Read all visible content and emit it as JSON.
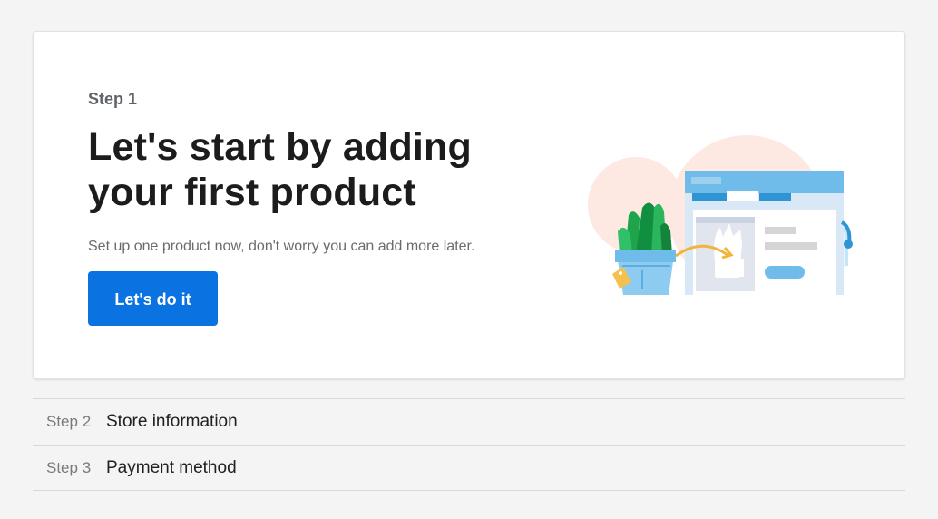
{
  "hero": {
    "step_label": "Step 1",
    "headline": "Let's start by adding your first product",
    "subtext": "Set up one product now, don't worry you can add more later.",
    "cta_label": "Let's do it"
  },
  "steps": [
    {
      "number": "Step 2",
      "title": "Store information"
    },
    {
      "number": "Step 3",
      "title": "Payment method"
    }
  ],
  "colors": {
    "page_bg": "#f4f4f4",
    "card_bg": "#ffffff",
    "primary": "#0a73e1",
    "illustration_blob": "#fde9e2",
    "window_blue": "#6fbbea",
    "plant_green": "#1ea44a",
    "pot_blue": "#8ecbf0",
    "arrow_yellow": "#f3b43c"
  },
  "icons": {
    "illustration": "product-listing-illustration"
  }
}
